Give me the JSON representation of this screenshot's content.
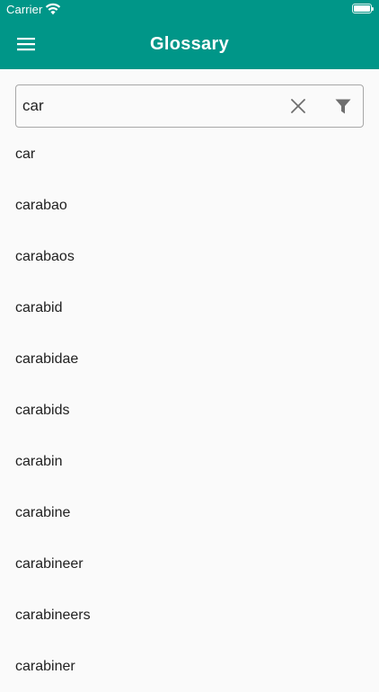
{
  "status_bar": {
    "carrier": "Carrier"
  },
  "app_bar": {
    "title": "Glossary",
    "background_color": "#009688",
    "menu_icon": "hamburger-menu-icon"
  },
  "search": {
    "value": "car",
    "clear_icon": "close-icon",
    "filter_icon": "filter-icon"
  },
  "results": [
    "car",
    "carabao",
    "carabaos",
    "carabid",
    "carabidae",
    "carabids",
    "carabin",
    "carabine",
    "carabineer",
    "carabineers",
    "carabiner"
  ]
}
